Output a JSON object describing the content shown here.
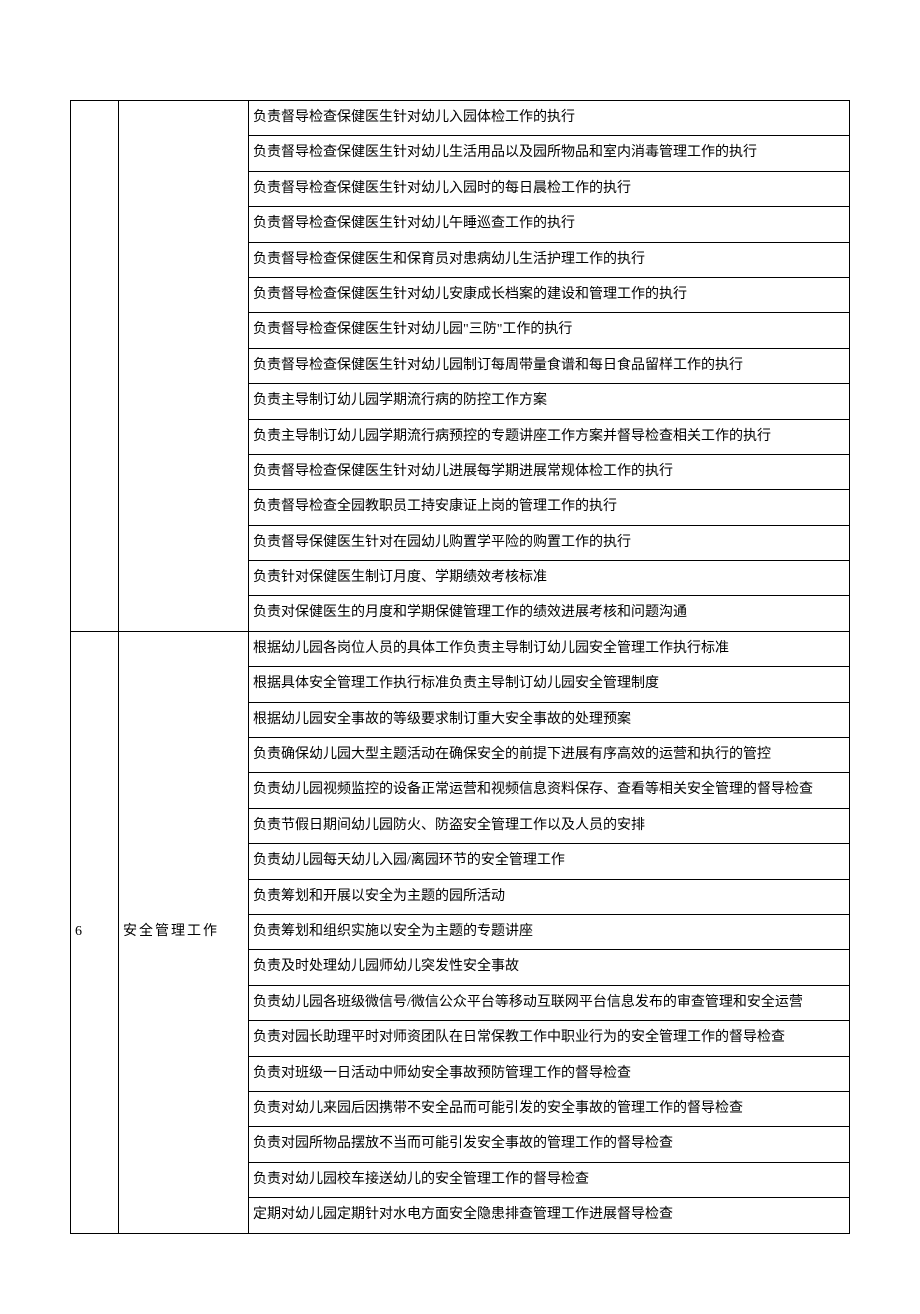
{
  "groups": [
    {
      "index": "",
      "category": "",
      "items": [
        "负责督导检查保健医生针对幼儿入园体检工作的执行",
        "负责督导检查保健医生针对幼儿生活用品以及园所物品和室内消毒管理工作的执行",
        "负责督导检查保健医生针对幼儿入园时的每日晨检工作的执行",
        "负责督导检查保健医生针对幼儿午睡巡查工作的执行",
        "负责督导检查保健医生和保育员对患病幼儿生活护理工作的执行",
        "负责督导检查保健医生针对幼儿安康成长档案的建设和管理工作的执行",
        "负责督导检查保健医生针对幼儿园\"三防\"工作的执行",
        "负责督导检查保健医生针对幼儿园制订每周带量食谱和每日食品留样工作的执行",
        "负责主导制订幼儿园学期流行病的防控工作方案",
        "负责主导制订幼儿园学期流行病预控的专题讲座工作方案并督导检查相关工作的执行",
        "负责督导检查保健医生针对幼儿进展每学期进展常规体检工作的执行",
        "负责督导检查全园教职员工持安康证上岗的管理工作的执行",
        "负责督导保健医生针对在园幼儿购置学平险的购置工作的执行",
        "负责针对保健医生制订月度、学期绩效考核标准",
        "负责对保健医生的月度和学期保健管理工作的绩效进展考核和问题沟通"
      ]
    },
    {
      "index": "6",
      "category": "安全管理工作",
      "items": [
        "根据幼儿园各岗位人员的具体工作负责主导制订幼儿园安全管理工作执行标准",
        "根据具体安全管理工作执行标准负责主导制订幼儿园安全管理制度",
        "根据幼儿园安全事故的等级要求制订重大安全事故的处理预案",
        "负责确保幼儿园大型主题活动在确保安全的前提下进展有序高效的运营和执行的管控",
        "负责幼儿园视频监控的设备正常运营和视频信息资料保存、查看等相关安全管理的督导检查",
        "负责节假日期间幼儿园防火、防盗安全管理工作以及人员的安排",
        "负责幼儿园每天幼儿入园/离园环节的安全管理工作",
        "负责筹划和开展以安全为主题的园所活动",
        "负责筹划和组织实施以安全为主题的专题讲座",
        "负责及时处理幼儿园师幼儿突发性安全事故",
        "负责幼儿园各班级微信号/微信公众平台等移动互联网平台信息发布的审查管理和安全运营",
        "负责对园长助理平时对师资团队在日常保教工作中职业行为的安全管理工作的督导检查",
        "负责对班级一日活动中师幼安全事故预防管理工作的督导检查",
        "负责对幼儿来园后因携带不安全品而可能引发的安全事故的管理工作的督导检查",
        "负责对园所物品摆放不当而可能引发安全事故的管理工作的督导检查",
        "负责对幼儿园校车接送幼儿的安全管理工作的督导检查",
        "定期对幼儿园定期针对水电方面安全隐患排查管理工作进展督导检查"
      ]
    }
  ]
}
